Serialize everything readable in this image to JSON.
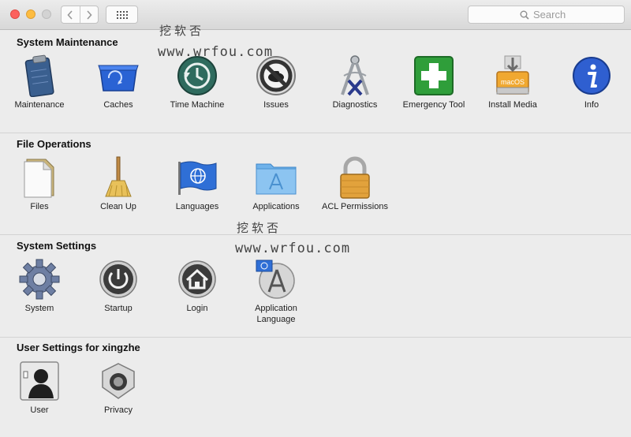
{
  "toolbar": {
    "search_placeholder": "Search"
  },
  "sections": [
    {
      "title": "System Maintenance",
      "items": [
        {
          "label": "Maintenance",
          "icon": "clipboard-icon"
        },
        {
          "label": "Caches",
          "icon": "bin-icon"
        },
        {
          "label": "Time Machine",
          "icon": "time-machine-icon"
        },
        {
          "label": "Issues",
          "icon": "no-entry-icon"
        },
        {
          "label": "Diagnostics",
          "icon": "calipers-icon"
        },
        {
          "label": "Emergency Tool",
          "icon": "first-aid-icon"
        },
        {
          "label": "Install Media",
          "icon": "install-drive-icon"
        },
        {
          "label": "Info",
          "icon": "info-icon"
        }
      ]
    },
    {
      "title": "File Operations",
      "items": [
        {
          "label": "Files",
          "icon": "document-icon"
        },
        {
          "label": "Clean Up",
          "icon": "broom-icon"
        },
        {
          "label": "Languages",
          "icon": "flag-globe-icon"
        },
        {
          "label": "Applications",
          "icon": "applications-folder-icon"
        },
        {
          "label": "ACL Permissions",
          "icon": "padlock-icon"
        }
      ]
    },
    {
      "title": "System Settings",
      "items": [
        {
          "label": "System",
          "icon": "gear-icon"
        },
        {
          "label": "Startup",
          "icon": "power-icon"
        },
        {
          "label": "Login",
          "icon": "home-icon"
        },
        {
          "label": "Application Language",
          "icon": "app-store-flag-icon"
        }
      ]
    },
    {
      "title": "User Settings for xingzhe",
      "items": [
        {
          "label": "User",
          "icon": "user-silhouette-icon"
        },
        {
          "label": "Privacy",
          "icon": "privacy-lock-icon"
        }
      ]
    }
  ],
  "install_badge": "macOS",
  "watermarks": [
    {
      "line1": "挖软否",
      "line2": "www.wrfou.com"
    },
    {
      "line1": "挖软否",
      "line2": "www.wrfou.com"
    }
  ],
  "colors": {
    "accent_blue": "#2f6fd6",
    "emergency_green": "#2f9e3a",
    "toolbar_bg": "#d8d8d8",
    "window_bg": "#ececec"
  }
}
